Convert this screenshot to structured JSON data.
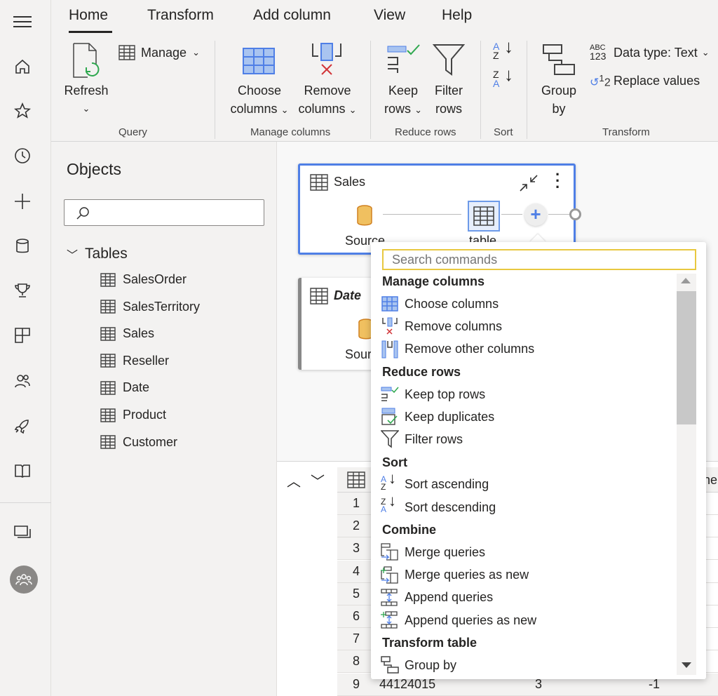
{
  "ribbon_tabs": [
    "Home",
    "Transform",
    "Add column",
    "View",
    "Help"
  ],
  "ribbon": {
    "refresh": "Refresh",
    "manage": "Manage",
    "query_group": "Query",
    "choose": "Choose",
    "choose2": "columns",
    "remove": "Remove",
    "remove2": "columns",
    "manage_cols_group": "Manage columns",
    "keep": "Keep",
    "keep2": "rows",
    "filter": "Filter",
    "filter2": "rows",
    "reduce_group": "Reduce rows",
    "sort_group": "Sort",
    "group": "Group",
    "group2": "by",
    "datatype": "Data type: Text",
    "replace": "Replace values",
    "transform_group": "Transform"
  },
  "objects": {
    "title": "Objects",
    "search_placeholder": "",
    "tables_label": "Tables",
    "tables": [
      "SalesOrder",
      "SalesTerritory",
      "Sales",
      "Reseller",
      "Date",
      "Product",
      "Customer"
    ]
  },
  "canvas": {
    "card1": {
      "title": "Sales",
      "step1": "Source",
      "step2": "table"
    },
    "card2": {
      "title": "Date",
      "step1": "Source"
    }
  },
  "popup": {
    "search_placeholder": "Search commands",
    "sections": [
      {
        "title": "Manage columns",
        "items": [
          "Choose columns",
          "Remove columns",
          "Remove other columns"
        ]
      },
      {
        "title": "Reduce rows",
        "items": [
          "Keep top rows",
          "Keep duplicates",
          "Filter rows"
        ]
      },
      {
        "title": "Sort",
        "items": [
          "Sort ascending",
          "Sort descending"
        ]
      },
      {
        "title": "Combine",
        "items": [
          "Merge queries",
          "Merge queries as new",
          "Append queries",
          "Append queries as new"
        ]
      },
      {
        "title": "Transform table",
        "items": [
          "Group by"
        ]
      }
    ]
  },
  "grid": {
    "rows": [
      "1",
      "2",
      "3",
      "4",
      "5",
      "6",
      "7",
      "8",
      "9"
    ],
    "last_row": [
      "44124015",
      "3",
      "-1"
    ],
    "header_fragment": "ne"
  },
  "colors": {
    "accent": "#4f7fe6",
    "search_border": "#e8c840",
    "source_icon": "#f0c060"
  }
}
